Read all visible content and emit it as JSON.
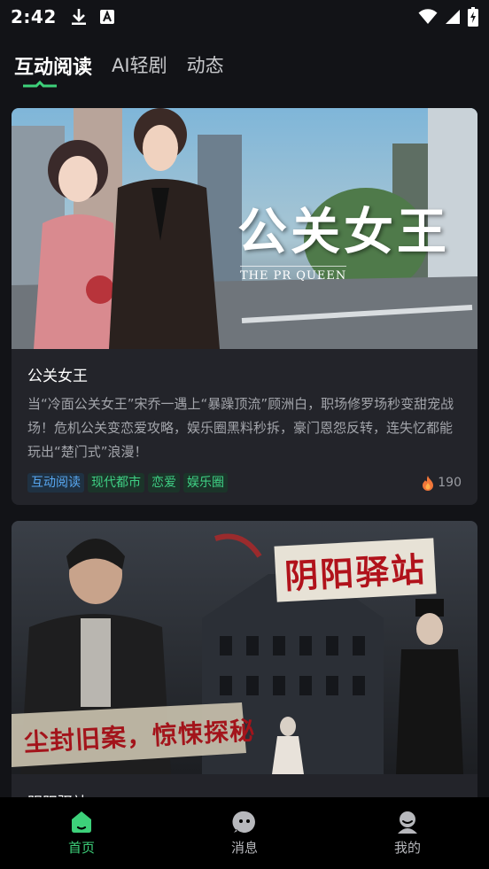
{
  "status_bar": {
    "time": "2:42"
  },
  "top_tabs": [
    {
      "label": "互动阅读",
      "active": true
    },
    {
      "label": "AI轻剧",
      "active": false
    },
    {
      "label": "动态",
      "active": false
    }
  ],
  "cards": [
    {
      "cover_title": "公关女王",
      "cover_subtitle": "THE PR QUEEN",
      "title": "公关女王",
      "description": "当“冷面公关女王”宋乔一遇上“暴躁顶流”顾洲白，职场修罗场秒变甜宠战场！危机公关变恋爱攻略，娱乐圈黑料秒拆，豪门恩怨反转，连失忆都能玩出“楚门式”浪漫！",
      "tags": [
        "互动阅读",
        "现代都市",
        "恋爱",
        "娱乐圈"
      ],
      "heat": "190"
    },
    {
      "cover_title": "阴阳驿站",
      "cover_caption": "尘封旧案，惊悚探秘",
      "title": "阴阳驿站"
    }
  ],
  "bottom_nav": [
    {
      "label": "首页",
      "icon": "home-icon",
      "active": true
    },
    {
      "label": "消息",
      "icon": "message-icon",
      "active": false
    },
    {
      "label": "我的",
      "icon": "profile-icon",
      "active": false
    }
  ],
  "colors": {
    "accent": "#3dd17a",
    "tag_blue": "#58a8f2",
    "tag_green": "#3fcf84",
    "background": "#121317",
    "card": "#23242a"
  }
}
